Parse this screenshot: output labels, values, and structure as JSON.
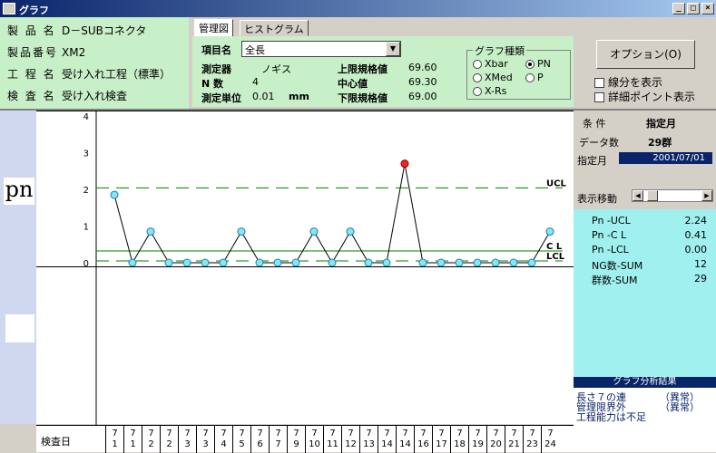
{
  "window": {
    "title": "グラフ"
  },
  "info": {
    "product_name_label": "製 品 名",
    "product_name": "D－SUBコネクタ",
    "product_no_label": "製品番号",
    "product_no": "XM2",
    "process_label": "工 程 名",
    "process": "受け入れ工程（標準）",
    "inspection_label": "検 査 名",
    "inspection": "受け入れ検査"
  },
  "tabs": [
    {
      "label": "管理図",
      "active": true
    },
    {
      "label": "ヒストグラム",
      "active": false
    }
  ],
  "panel": {
    "item_label": "項目名",
    "item_value": "全長",
    "instrument_label": "測定器",
    "instrument_value": "ノギス",
    "n_label": "N 数",
    "n_value": "4",
    "unit_label": "測定単位",
    "unit_value": "0.01",
    "unit_suffix": "mm",
    "usl_label": "上限規格値",
    "usl_value": "69.60",
    "center_label": "中心値",
    "center_value": "69.30",
    "lsl_label": "下限規格値",
    "lsl_value": "69.00"
  },
  "graph_type": {
    "legend": "グラフ種類",
    "options": [
      {
        "label": "Xbar",
        "checked": false
      },
      {
        "label": "PN",
        "checked": true
      },
      {
        "label": "XMed",
        "checked": false
      },
      {
        "label": "P",
        "checked": false
      },
      {
        "label": "X-Rs",
        "checked": false
      }
    ]
  },
  "option_button": "オプション(O)",
  "checks": {
    "segment": "線分を表示",
    "detail": "詳細ポイント表示"
  },
  "chart_label": "pn",
  "chart_data": {
    "type": "line",
    "ylim": [
      0,
      4
    ],
    "y_ticks": [
      "0",
      "1",
      "2",
      "3",
      "4"
    ],
    "values": [
      1.85,
      0,
      0.85,
      0,
      0,
      0,
      0,
      0.85,
      0,
      0,
      0,
      0.85,
      0,
      0.85,
      0,
      0,
      2.7,
      0,
      0,
      0,
      0,
      0,
      0,
      0,
      0.85
    ],
    "ucl": 2.04,
    "cl": 0.32,
    "lcl": 0,
    "ucl_label": "UCL",
    "cl_label": "C L",
    "lcl_label": "LCL",
    "out_of_control_index": 16
  },
  "dates": {
    "label": "検査日",
    "months": [
      "7",
      "7",
      "7",
      "7",
      "7",
      "7",
      "7",
      "7",
      "7",
      "7",
      "7",
      "7",
      "7",
      "7",
      "7",
      "7",
      "7",
      "7",
      "7",
      "7",
      "7",
      "7",
      "7",
      "7",
      "7"
    ],
    "days": [
      "1",
      "1",
      "2",
      "2",
      "3",
      "3",
      "4",
      "5",
      "6",
      "7",
      "9",
      "10",
      "11",
      "12",
      "13",
      "14",
      "14",
      "16",
      "17",
      "18",
      "19",
      "20",
      "21",
      "23",
      "24"
    ]
  },
  "right": {
    "cond_label": "条 件",
    "cond_value": "指定月",
    "count_label": "データ数",
    "count_value": "29群",
    "month_label": "指定月",
    "month_value": "2001/07/01",
    "nav_label": "表示移動"
  },
  "stats": [
    {
      "label": "Pn  -UCL",
      "value": "2.24"
    },
    {
      "label": "Pn  -C L",
      "value": "0.41"
    },
    {
      "label": "Pn  -LCL",
      "value": "0.00"
    },
    {
      "label": "NG数-SUM",
      "value": "12"
    },
    {
      "label": "群数-SUM",
      "value": "29"
    }
  ],
  "result": {
    "title": "グラフ分析結果",
    "lines": [
      {
        "text": "長さ７の連",
        "status": "（異常）"
      },
      {
        "text": "管理限界外",
        "status": "（異常）"
      },
      {
        "text": "工程能力は不足",
        "status": ""
      }
    ]
  }
}
